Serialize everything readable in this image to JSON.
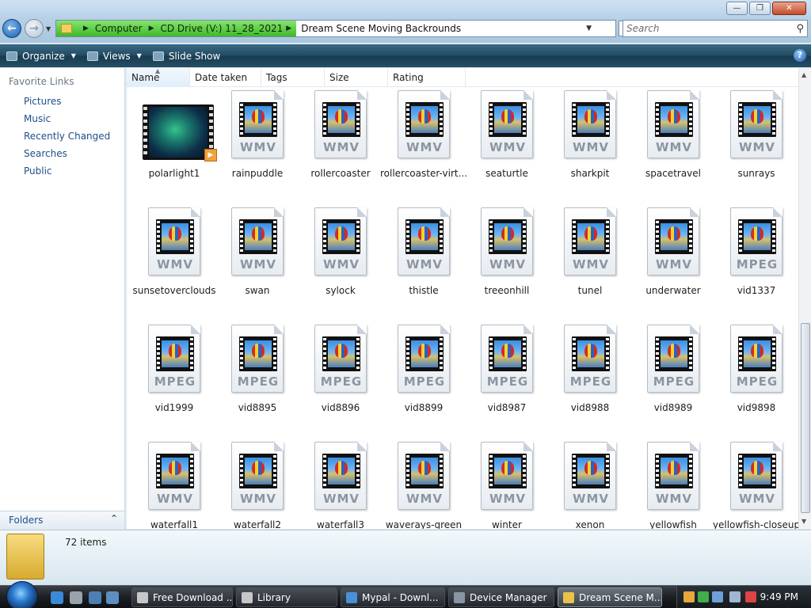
{
  "window": {
    "minimize_glyph": "—",
    "maximize_glyph": "❐",
    "close_glyph": "✕"
  },
  "address": {
    "crumbs": [
      "Computer",
      "CD Drive (V:) 11_28_2021"
    ],
    "current": "Dream Scene Moving Backrounds",
    "stop_glyph": "✕"
  },
  "search": {
    "placeholder": "Search",
    "icon": "magnifier-icon"
  },
  "toolbar": {
    "organize_label": "Organize",
    "views_label": "Views",
    "slideshow_label": "Slide Show",
    "help_label": "?"
  },
  "nav": {
    "title": "Favorite Links",
    "items": [
      {
        "label": "Pictures",
        "icon": "pictures-icon",
        "color": "#3b7fc7"
      },
      {
        "label": "Music",
        "icon": "music-icon",
        "color": "#3b7fc7"
      },
      {
        "label": "Recently Changed",
        "icon": "recent-icon",
        "color": "#4f8ccf"
      },
      {
        "label": "Searches",
        "icon": "searches-icon",
        "color": "#4f8ccf"
      },
      {
        "label": "Public",
        "icon": "public-folder-icon",
        "color": "#e8c24a"
      }
    ],
    "folders_label": "Folders",
    "folders_chevron": "⌃"
  },
  "columns": [
    "Name",
    "Date taken",
    "Tags",
    "Size",
    "Rating"
  ],
  "files": [
    {
      "name": "polarlight1",
      "ext": "thumb"
    },
    {
      "name": "rainpuddle",
      "ext": "WMV"
    },
    {
      "name": "rollercoaster",
      "ext": "WMV"
    },
    {
      "name": "rollercoaster-virt...",
      "ext": "WMV"
    },
    {
      "name": "seaturtle",
      "ext": "WMV"
    },
    {
      "name": "sharkpit",
      "ext": "WMV"
    },
    {
      "name": "spacetravel",
      "ext": "WMV"
    },
    {
      "name": "sunrays",
      "ext": "WMV"
    },
    {
      "name": "sunsetoverclouds",
      "ext": "WMV"
    },
    {
      "name": "swan",
      "ext": "WMV"
    },
    {
      "name": "sylock",
      "ext": "WMV"
    },
    {
      "name": "thistle",
      "ext": "WMV"
    },
    {
      "name": "treeonhill",
      "ext": "WMV"
    },
    {
      "name": "tunel",
      "ext": "WMV"
    },
    {
      "name": "underwater",
      "ext": "WMV"
    },
    {
      "name": "vid1337",
      "ext": "MPEG"
    },
    {
      "name": "vid1999",
      "ext": "MPEG"
    },
    {
      "name": "vid8895",
      "ext": "MPEG"
    },
    {
      "name": "vid8896",
      "ext": "MPEG"
    },
    {
      "name": "vid8899",
      "ext": "MPEG"
    },
    {
      "name": "vid8987",
      "ext": "MPEG"
    },
    {
      "name": "vid8988",
      "ext": "MPEG"
    },
    {
      "name": "vid8989",
      "ext": "MPEG"
    },
    {
      "name": "vid9898",
      "ext": "MPEG"
    },
    {
      "name": "waterfall1",
      "ext": "WMV"
    },
    {
      "name": "waterfall2",
      "ext": "WMV"
    },
    {
      "name": "waterfall3",
      "ext": "WMV"
    },
    {
      "name": "waverays-green",
      "ext": "WMV"
    },
    {
      "name": "winter",
      "ext": "WMV"
    },
    {
      "name": "xenon",
      "ext": "WMV"
    },
    {
      "name": "yellowfish",
      "ext": "WMV"
    },
    {
      "name": "yellowfish-closeup",
      "ext": "WMV"
    }
  ],
  "details": {
    "count": "72 items"
  },
  "taskbar": {
    "tasks": [
      {
        "label": "Free Download ...",
        "icon": "firefox-icon",
        "active": false
      },
      {
        "label": "Library",
        "icon": "firefox-icon",
        "active": false
      },
      {
        "label": "Mypal - Downl...",
        "icon": "mypal-icon",
        "active": false
      },
      {
        "label": "Device Manager",
        "icon": "device-manager-icon",
        "active": false
      },
      {
        "label": "Dream Scene M...",
        "icon": "folder-icon",
        "active": true
      }
    ],
    "clock": "9:49 PM"
  }
}
